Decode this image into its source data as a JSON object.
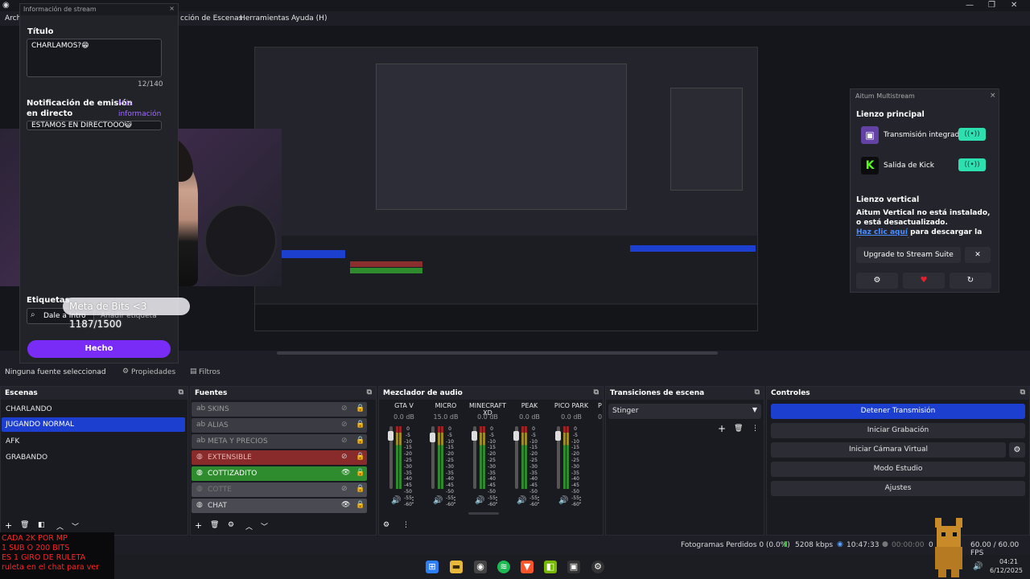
{
  "window": {
    "menu": [
      "Arch",
      "cción de Escenas",
      "Herramientas",
      "Ayuda (H)"
    ]
  },
  "dialog": {
    "header": "Información de stream",
    "close": "×",
    "titulo_label": "Título",
    "titulo_value": "CHARLAMOS?😁",
    "char_count": "12/140",
    "notif_label_line1": "Notificación de emisión",
    "notif_label_line2": "en directo",
    "mas_info": "Más información",
    "notif_value": "ESTAMOS EN DIRECTOOO😺",
    "etiquetas_label": "Etiquetas",
    "search_placeholder": "Dale a Intro",
    "add_tag": "Añadir etiqueta",
    "done_button": "Hecho"
  },
  "overlay": {
    "bits_goal": "Meta de Bits <3 1187/1500"
  },
  "aitum": {
    "header": "Aitum Multistream",
    "close": "×",
    "main_canvas": "Lienzo principal",
    "outputs": [
      {
        "name": "Transmisión integrada",
        "icon": "twitch-icon"
      },
      {
        "name": "Salida de Kick",
        "icon": "kick-icon"
      }
    ],
    "toggle_icon": "((•))",
    "vertical_canvas": "Lienzo vertical",
    "vertical_msg": "Aitum Vertical no está instalado, o está desactualizado.",
    "link_text": "Haz clic aquí",
    "link_rest": "para descargar la última versión",
    "upgrade_button": "Upgrade to Stream Suite",
    "x_button": "✕"
  },
  "source_bar": {
    "no_source": "Ninguna fuente seleccionad",
    "properties": "Propiedades",
    "filters": "Filtros"
  },
  "scenes": {
    "title": "Escenas",
    "items": [
      "CHARLANDO",
      "JUGANDO NORMAL",
      "AFK",
      "GRABANDO"
    ],
    "active_index": 1
  },
  "sources": {
    "title": "Fuentes",
    "items": [
      {
        "name": "SKINS",
        "style": "grey"
      },
      {
        "name": "ALIAS",
        "style": "grey"
      },
      {
        "name": "META Y PRECIOS",
        "style": "grey"
      },
      {
        "name": "EXTENSIBLE",
        "style": "red"
      },
      {
        "name": "COTTIZADITO",
        "style": "green"
      },
      {
        "name": "COTTE",
        "style": "light"
      },
      {
        "name": "CHAT",
        "style": "light"
      }
    ]
  },
  "mixer": {
    "title": "Mezclador de audio",
    "channels": [
      {
        "name": "GTA V",
        "db": "0.0 dB",
        "level": 0.92
      },
      {
        "name": "MICRO",
        "db": "15.0 dB",
        "level": 0.9
      },
      {
        "name": "MINECRAFT XD",
        "db": "0.0 dB",
        "level": 0.92
      },
      {
        "name": "PEAK",
        "db": "0.0 dB",
        "level": 0.92
      },
      {
        "name": "PICO PARK",
        "db": "0.0 dB",
        "level": 0.92
      }
    ],
    "next_partial": "P",
    "next_db_partial": "0",
    "scale": [
      "0",
      "-5",
      "-10",
      "-15",
      "-20",
      "-25",
      "-30",
      "-35",
      "-40",
      "-45",
      "-50",
      "-55",
      "-60"
    ]
  },
  "transitions": {
    "title": "Transiciones de escena",
    "selected": "Stinger"
  },
  "controls": {
    "title": "Controles",
    "buttons": [
      "Detener Transmisión",
      "Iniciar Grabación",
      "Iniciar Cámara Virtual",
      "Modo Estudio",
      "Ajustes"
    ]
  },
  "status": {
    "dropped": "Fotogramas Perdidos 0 (0.0%)",
    "bitrate": "5208 kbps",
    "stream_time": "10:47:33",
    "rec_time": "00:00:00",
    "cpu": "0",
    "fps": "60.00 / 60.00 FPS"
  },
  "alert_overlay": [
    "CADA 2K POR MP",
    "1 SUB O 200 BITS",
    "ES 1 GIRO DE RULETA",
    "ruleta en el chat para ver"
  ],
  "taskbar": {
    "time": "04:21",
    "date": "6/12/2025"
  },
  "colors": {
    "accent_blue": "#1c3fcf",
    "twitch": "#6441a5",
    "kick": "#53fc18",
    "purple_btn": "#7a2cf7",
    "toggle": "#2de0b0"
  }
}
